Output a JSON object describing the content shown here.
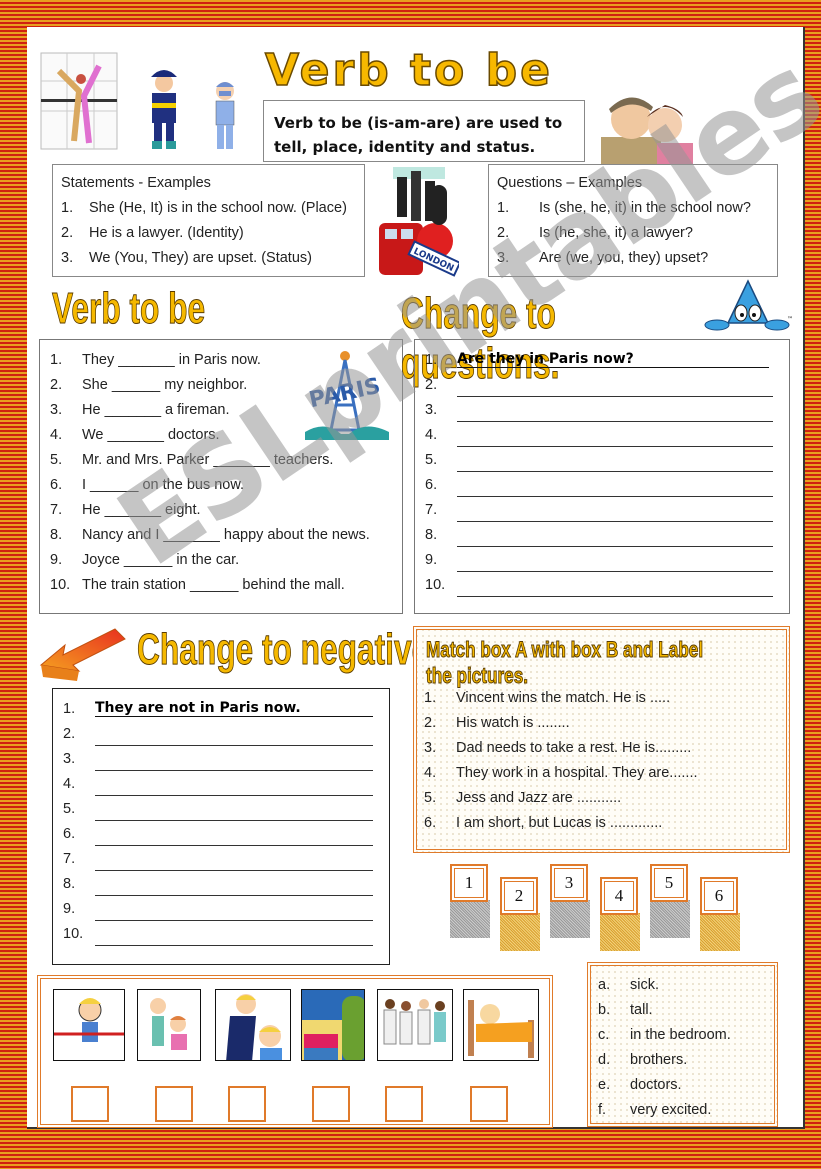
{
  "title": "Verb to be",
  "intro": "Verb to be (is-am-are) are used to tell, place, identity and status.",
  "statements": {
    "heading": "Statements - Examples",
    "items": [
      {
        "num": "1.",
        "text": "She (He, It) is in the school now. (Place)"
      },
      {
        "num": "2.",
        "text": "He is a lawyer. (Identity)"
      },
      {
        "num": "3.",
        "text": "We (You, They) are upset. (Status)"
      }
    ]
  },
  "questions_examples": {
    "heading": "Questions – Examples",
    "items": [
      {
        "num": "1.",
        "text": "Is (she, he, it) in the school now?"
      },
      {
        "num": "2.",
        "text": "Is (he, she, it) a lawyer?"
      },
      {
        "num": "3.",
        "text": "Are (we, you, they) upset?"
      }
    ]
  },
  "verb_section": {
    "heading": "Verb to be",
    "items": [
      {
        "num": "1.",
        "text": "They _______ in Paris now."
      },
      {
        "num": "2.",
        "text": "She ______ my neighbor."
      },
      {
        "num": "3.",
        "text": "He _______ a fireman."
      },
      {
        "num": "4.",
        "text": "We _______ doctors."
      },
      {
        "num": "5.",
        "text": "Mr. and Mrs. Parker _______ teachers."
      },
      {
        "num": "6.",
        "text": "I ______ on the bus now."
      },
      {
        "num": "7.",
        "text": "He _______ eight."
      },
      {
        "num": "8.",
        "text": "Nancy and I _______ happy about the news."
      },
      {
        "num": "9.",
        "text": "Joyce ______ in the car."
      },
      {
        "num": "10.",
        "text": "The train station ______ behind the mall."
      }
    ],
    "image_label": "PARIS"
  },
  "questions_section": {
    "heading": "Change to questions.",
    "example": "Are they in Paris now?",
    "nums": [
      "1.",
      "2.",
      "3.",
      "4.",
      "5.",
      "6.",
      "7.",
      "8.",
      "9.",
      "10."
    ]
  },
  "negatives_section": {
    "heading": "Change to negatives.",
    "example": "They are not in Paris now.",
    "nums": [
      "1.",
      "2.",
      "3.",
      "4.",
      "5.",
      "6.",
      "7.",
      "8.",
      "9.",
      "10."
    ]
  },
  "match_section": {
    "heading": "Match box A with box B and Label the pictures.",
    "items": [
      {
        "num": "1.",
        "text": "Vincent wins the match.   He is ....."
      },
      {
        "num": "2.",
        "text": "His watch is ........"
      },
      {
        "num": "3.",
        "text": "Dad needs to take a rest.   He is........."
      },
      {
        "num": "4.",
        "text": "They work in a hospital.   They are......."
      },
      {
        "num": "5.",
        "text": "Jess and Jazz are ..........."
      },
      {
        "num": "6.",
        "text": "I am short, but Lucas is ............."
      }
    ],
    "cards": [
      "1",
      "2",
      "3",
      "4",
      "5",
      "6"
    ]
  },
  "box_b": {
    "items": [
      {
        "letter": "a.",
        "text": "sick."
      },
      {
        "letter": "b.",
        "text": "tall."
      },
      {
        "letter": "c.",
        "text": "in the bedroom."
      },
      {
        "letter": "d.",
        "text": "brothers."
      },
      {
        "letter": "e.",
        "text": "doctors."
      },
      {
        "letter": "f.",
        "text": "very excited."
      }
    ]
  },
  "pictures": [
    "excited-boy-picture",
    "sisters-picture",
    "tall-man-boy-picture",
    "bedroom-picture",
    "doctors-picture",
    "sick-in-bed-picture"
  ],
  "image_labels": {
    "london": "LONDON"
  },
  "watermark": "ESLprintables.com",
  "colors": {
    "accent_orange": "#e07a2a",
    "title_gold": "#f5b800",
    "border_red": "#d02010",
    "border_yellow": "#e8a020"
  }
}
